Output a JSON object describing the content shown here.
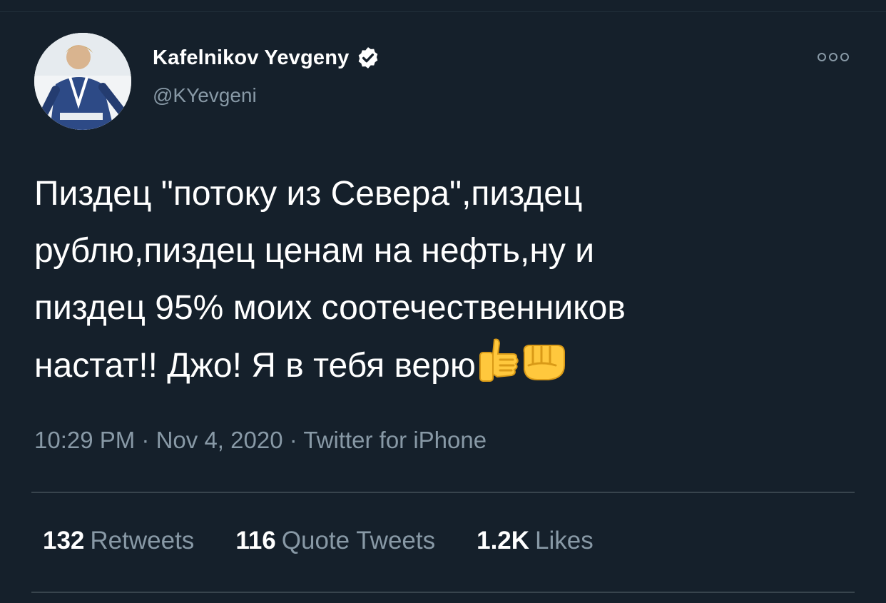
{
  "tweet": {
    "author": {
      "display_name": "Kafelnikov Yevgeny",
      "handle": "@KYevgeni",
      "verified": true
    },
    "text": "Пиздец \"потоку из Севера\",пиздец\nрублю,пиздец ценам на нефть,ну и\nпиздец 95% моих соотечественников\nнастат!! Джо! Я в тебя верю",
    "emojis": [
      "thumbs-up-icon",
      "fist-icon"
    ],
    "time": "10:29 PM",
    "date": "Nov 4, 2020",
    "source": "Twitter for iPhone",
    "separator": "·"
  },
  "stats": {
    "retweets": {
      "count": "132",
      "label": "Retweets"
    },
    "quote_tweets": {
      "count": "116",
      "label": "Quote Tweets"
    },
    "likes": {
      "count": "1.2K",
      "label": "Likes"
    }
  },
  "colors": {
    "background": "#15202b",
    "primary_text": "#ffffff",
    "secondary_text": "#8899a6",
    "divider": "#38444d",
    "emoji_yellow": "#ffc83d"
  }
}
